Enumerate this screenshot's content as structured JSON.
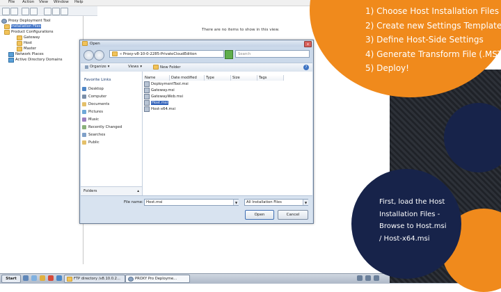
{
  "menu": [
    "File",
    "Action",
    "View",
    "Window",
    "Help"
  ],
  "tree": {
    "root": "Proxy Deployment Tool",
    "installation_files": "Installation Files",
    "product_configurations": "Product Configurations",
    "gateway": "Gateway",
    "host": "Host",
    "master": "Master",
    "network_places": "Network Places",
    "active_directory": "Active Directory Domains"
  },
  "main_pane": {
    "empty_message": "There are no items to show in this view."
  },
  "dialog": {
    "title": "Open",
    "close_glyph": "x",
    "address_path": "« Proxy-v8-10-0-2285-PrivateCloudEdition",
    "search_placeholder": "Search",
    "organize": "Organize",
    "views": "Views",
    "new_folder": "New Folder",
    "help_glyph": "?",
    "favorite_links_title": "Favorite Links",
    "favorites": [
      "Desktop",
      "Computer",
      "Documents",
      "Pictures",
      "Music",
      "Recently Changed",
      "Searches",
      "Public"
    ],
    "folders_label": "Folders",
    "columns": [
      "Name",
      "Date modified",
      "Type",
      "Size",
      "Tags"
    ],
    "files": [
      "DeploymentTool.msi",
      "Gateway.msi",
      "GatewayWeb.msi",
      "Host.msi",
      "Host-x64.msi"
    ],
    "selected_file": "Host.msi",
    "file_name_label": "File name:",
    "file_name_value": "Host.msi",
    "file_type": "All Installation Files",
    "open_label": "Open",
    "cancel_label": "Cancel"
  },
  "taskbar": {
    "start": "Start",
    "tasks": [
      "FTP directory /v8.10.0.2...",
      "PROXY Pro Deployme..."
    ]
  },
  "steps": [
    "1) Choose Host Installation Files",
    "2) Create new Settings Template",
    "3) Define Host-Side Settings",
    "4) Generate Transform File (.MST)",
    "5) Deploy!"
  ],
  "info_lines": [
    "First, load the Host",
    "Installation Files -",
    "Browse to Host.msi",
    "/ Host-x64.msi"
  ],
  "colors": {
    "accent_orange": "#f08a1c",
    "navy": "#17234a",
    "selection_blue": "#2e5fb8"
  }
}
